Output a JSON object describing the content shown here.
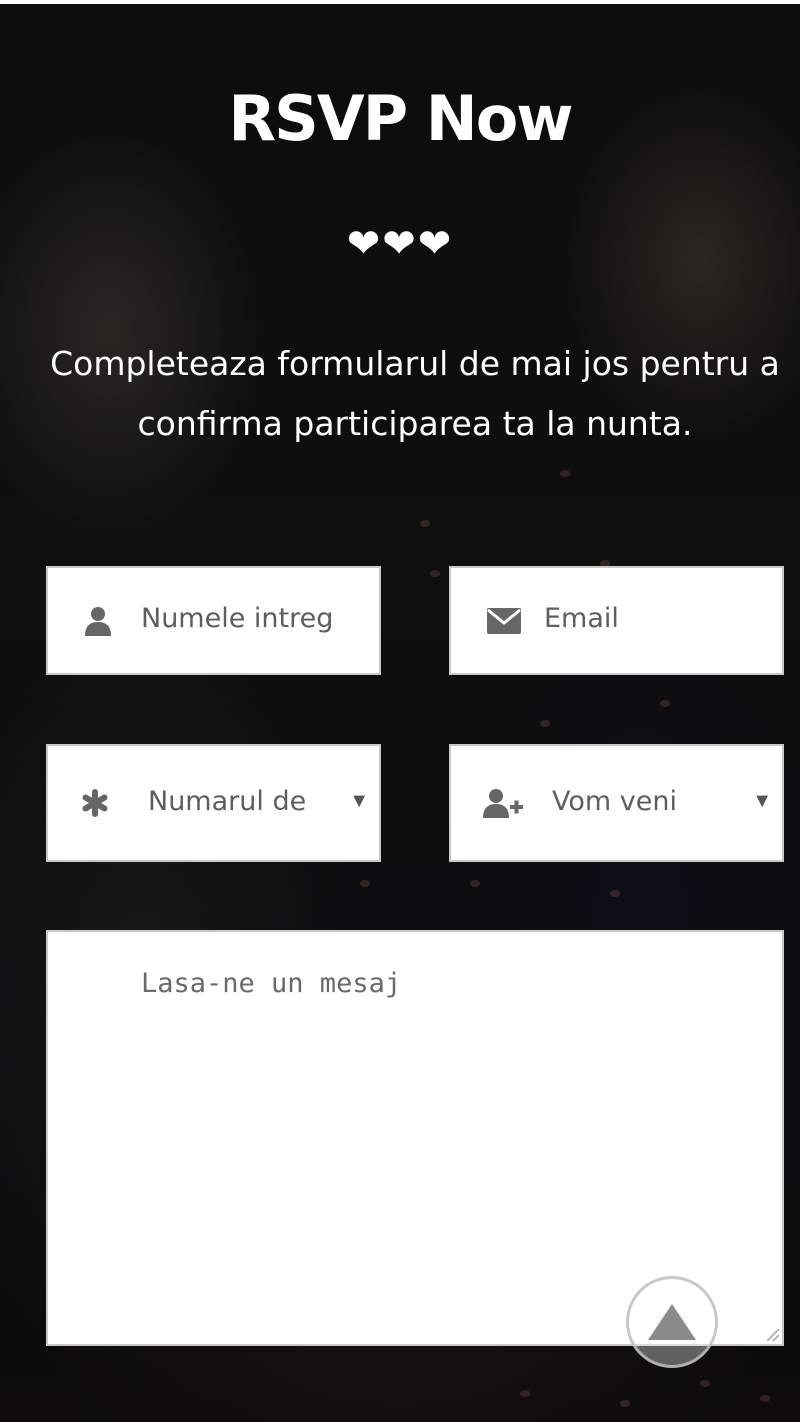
{
  "rsvp": {
    "title": "RSVP Now",
    "hearts": "❤❤❤",
    "subtitle": "Completeaza formularul de mai jos pentru a confirma participarea ta la nunta."
  },
  "form": {
    "name_field": {
      "placeholder": "Numele intreg",
      "icon": "user-icon"
    },
    "email_field": {
      "placeholder": "Email",
      "icon": "envelope-icon"
    },
    "guests_select": {
      "selected": "Numarul de",
      "icon": "asterisk-icon"
    },
    "attendance_select": {
      "selected": "Vom veni",
      "icon": "user-plus-icon"
    },
    "message": {
      "placeholder": "Lasa-ne un mesaj"
    }
  },
  "scroll_top": {
    "icon": "arrow-up-icon"
  },
  "colors": {
    "text": "#ffffff",
    "field_bg": "#ffffff",
    "placeholder": "#5e5e5e"
  }
}
